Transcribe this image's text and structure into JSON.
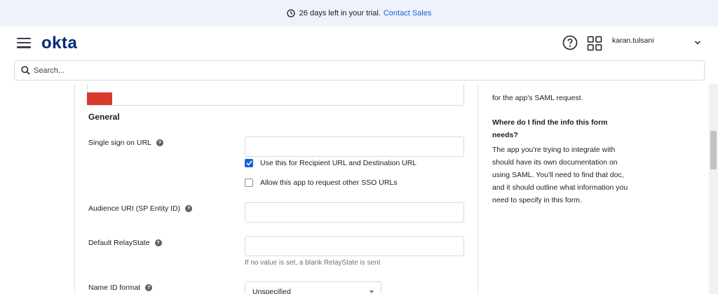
{
  "trial_banner": {
    "message": "26 days left in your trial.",
    "link": "Contact Sales"
  },
  "header": {
    "logo": "okta",
    "username": "karan.tulsani"
  },
  "search": {
    "placeholder": "Search..."
  },
  "form": {
    "section_title": "General",
    "single_sign_on": {
      "label": "Single sign on URL",
      "value": ""
    },
    "checkbox_recipient": {
      "label": "Use this for Recipient URL and Destination URL",
      "checked": true
    },
    "checkbox_other_sso": {
      "label": "Allow this app to request other SSO URLs",
      "checked": false
    },
    "audience_uri": {
      "label": "Audience URI (SP Entity ID)",
      "value": ""
    },
    "relay_state": {
      "label": "Default RelayState",
      "value": "",
      "hint": "If no value is set, a blank RelayState is sent"
    },
    "name_id_format": {
      "label": "Name ID format",
      "selected": "Unspecified"
    }
  },
  "sidebar_help": {
    "intro": "for the app's SAML request.",
    "heading": "Where do I find the info this form needs?",
    "body": "The app you're trying to integrate with should have its own documentation on using SAML. You'll need to find that doc, and it should outline what information you need to specify in this form."
  },
  "colors": {
    "accent": "#1662dd",
    "logo": "#00297a",
    "banner_bg": "#eef2fa",
    "red_mark": "#d93a2b"
  },
  "icons": [
    "clock-icon",
    "hamburger-icon",
    "help-icon",
    "apps-grid-icon",
    "chevron-down-icon",
    "search-icon",
    "info-icon",
    "checkmark-icon",
    "dropdown-arrow-icon"
  ]
}
